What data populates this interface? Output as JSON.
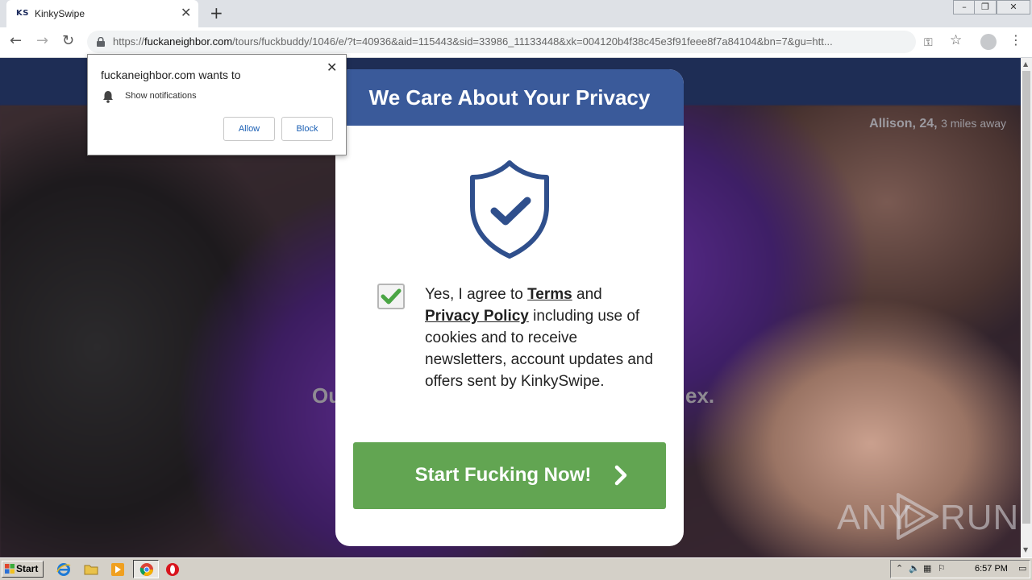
{
  "browser": {
    "tab": {
      "favicon_text": "KS",
      "title": "KinkySwipe"
    },
    "url": {
      "scheme": "https://",
      "host": "fuckaneighbor.com",
      "path": "/tours/fuckbuddy/1046/e/?t=40936&aid=115443&sid=33986_11133448&xk=004120b4f38c45e3f91feee8f7a84104&bn=7&gu=htt..."
    },
    "icons": [
      "back-icon",
      "forward-icon",
      "reload-icon",
      "lock-icon",
      "key-icon",
      "star-icon",
      "profile-avatar",
      "menu-icon"
    ]
  },
  "notification_prompt": {
    "title": "fuckaneighbor.com wants to",
    "permission": "Show notifications",
    "allow_label": "Allow",
    "block_label": "Block"
  },
  "page": {
    "profile_name": "Allison, 24,",
    "profile_distance": "3 miles away",
    "headline_left_fragment": "Ou",
    "headline_right_fragment": "ex."
  },
  "privacy_modal": {
    "title": "We Care About Your Privacy",
    "consent": {
      "checked": true,
      "prefix": "Yes, I agree to ",
      "terms_link": "Terms",
      "mid": " and ",
      "privacy_link": "Privacy Policy",
      "suffix": " including use of cookies and to receive newsletters, account updates and offers sent by KinkySwipe."
    },
    "cta_label": "Start Fucking Now!"
  },
  "colors": {
    "modal_header": "#3a5a9a",
    "shield": "#2f4f8c",
    "check_green": "#4aa544",
    "cta_green": "#62a552",
    "site_header": "#1e2d55"
  },
  "watermark": {
    "left": "ANY",
    "right": "RUN"
  },
  "taskbar": {
    "start_label": "Start",
    "clock": "6:57 PM",
    "icons": [
      "ie-icon",
      "folder-icon",
      "media-player-icon",
      "chrome-icon",
      "opera-icon"
    ]
  }
}
